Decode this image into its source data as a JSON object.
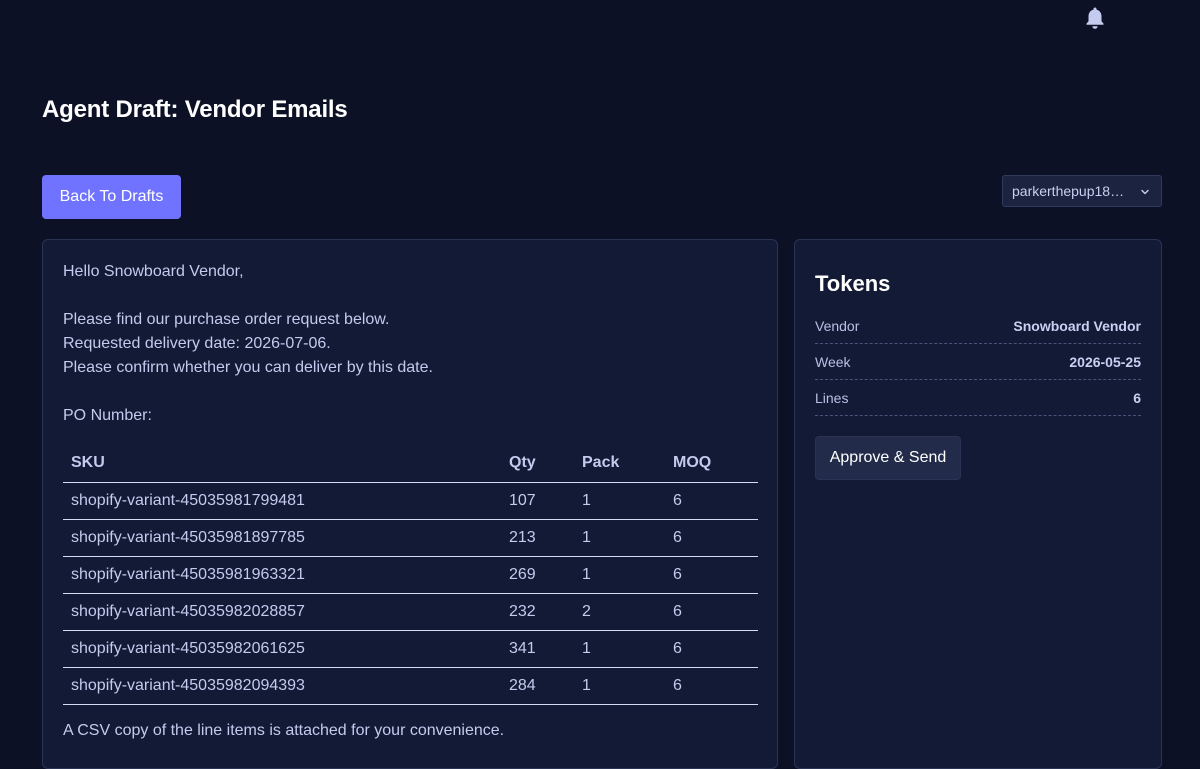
{
  "header": {
    "notifications_icon": "bell-icon"
  },
  "page": {
    "title": "Agent Draft: Vendor Emails"
  },
  "toolbar": {
    "back_label": "Back To Drafts",
    "account_selected": "parkerthepup18…",
    "account_chevron_icon": "chevron-down-icon"
  },
  "email": {
    "greeting": "Hello Snowboard Vendor,",
    "lines": [
      "Please find our purchase order request below.",
      "Requested delivery date: 2026-07-06.",
      "Please confirm whether you can deliver by this date."
    ],
    "po_label": "PO Number:",
    "table": {
      "headers": [
        "SKU",
        "Qty",
        "Pack",
        "MOQ"
      ],
      "rows": [
        [
          "shopify-variant-45035981799481",
          "107",
          "1",
          "6"
        ],
        [
          "shopify-variant-45035981897785",
          "213",
          "1",
          "6"
        ],
        [
          "shopify-variant-45035981963321",
          "269",
          "1",
          "6"
        ],
        [
          "shopify-variant-45035982028857",
          "232",
          "2",
          "6"
        ],
        [
          "shopify-variant-45035982061625",
          "341",
          "1",
          "6"
        ],
        [
          "shopify-variant-45035982094393",
          "284",
          "1",
          "6"
        ]
      ]
    },
    "closing": "A CSV copy of the line items is attached for your convenience."
  },
  "tokens": {
    "title": "Tokens",
    "items": [
      {
        "key": "Vendor",
        "value": "Snowboard Vendor"
      },
      {
        "key": "Week",
        "value": "2026-05-25"
      },
      {
        "key": "Lines",
        "value": "6"
      }
    ],
    "approve_label": "Approve & Send"
  },
  "colors": {
    "background": "#0d1126",
    "panel": "#131a35",
    "accent": "#7073ff"
  }
}
